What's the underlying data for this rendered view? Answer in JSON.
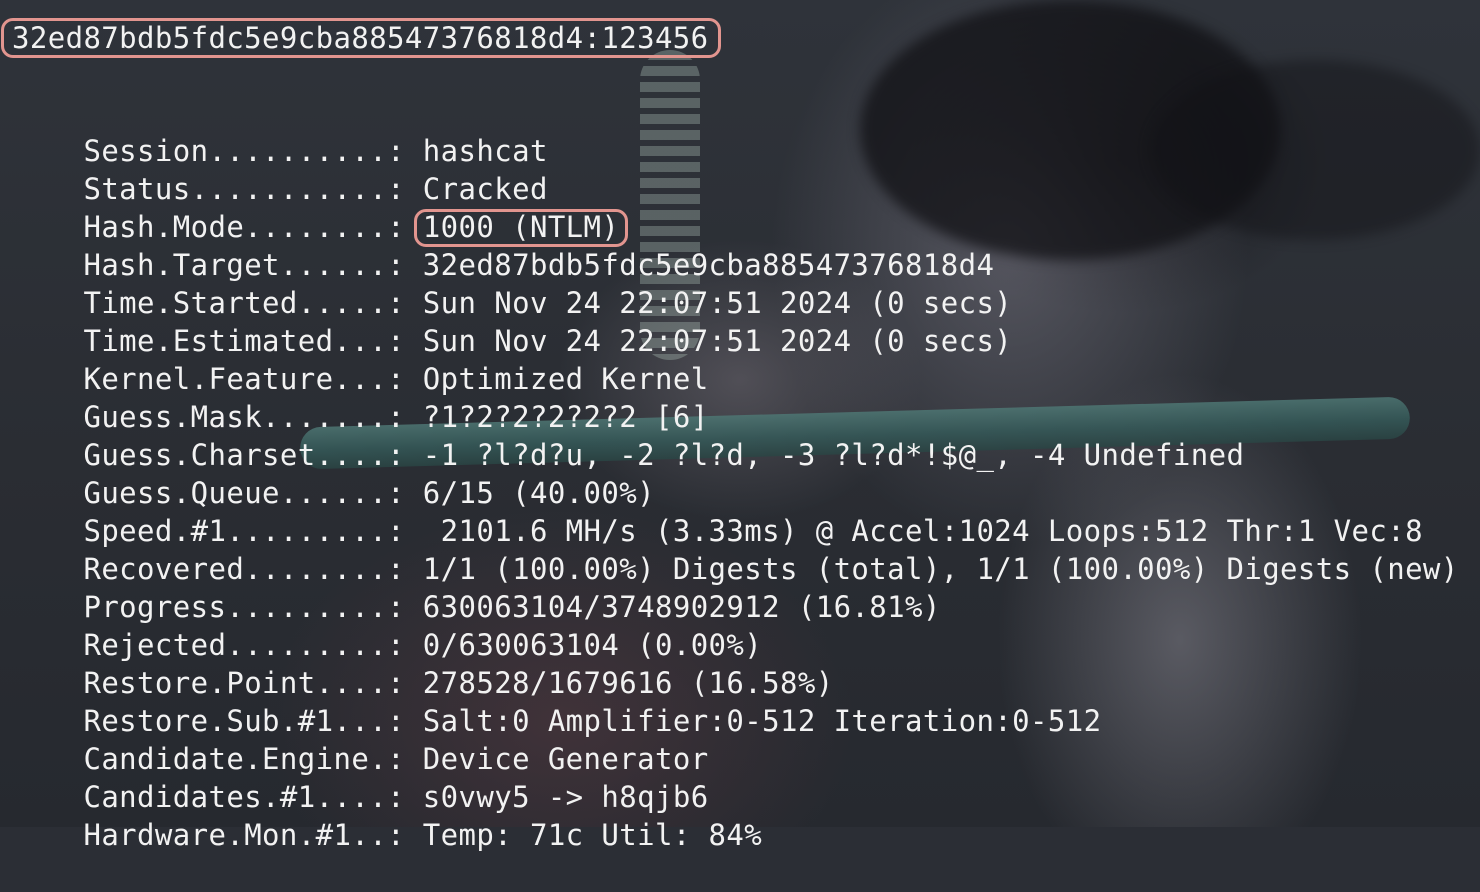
{
  "cracked_line": "32ed87bdb5fdc5e9cba88547376818d4:123456",
  "fields": [
    {
      "key": "Session..........: ",
      "value": "hashcat"
    },
    {
      "key": "Status...........: ",
      "value": "Cracked"
    },
    {
      "key": "Hash.Mode........: ",
      "value": "1000 (NTLM)"
    },
    {
      "key": "Hash.Target......: ",
      "value": "32ed87bdb5fdc5e9cba88547376818d4"
    },
    {
      "key": "Time.Started.....: ",
      "value": "Sun Nov 24 22:07:51 2024 (0 secs)"
    },
    {
      "key": "Time.Estimated...: ",
      "value": "Sun Nov 24 22:07:51 2024 (0 secs)"
    },
    {
      "key": "Kernel.Feature...: ",
      "value": "Optimized Kernel"
    },
    {
      "key": "Guess.Mask.......: ",
      "value": "?1?2?2?2?2?2 [6]"
    },
    {
      "key": "Guess.Charset....: ",
      "value": "-1 ?l?d?u, -2 ?l?d, -3 ?l?d*!$@_, -4 Undefined"
    },
    {
      "key": "Guess.Queue......: ",
      "value": "6/15 (40.00%)"
    },
    {
      "key": "Speed.#1.........: ",
      "value": " 2101.6 MH/s (3.33ms) @ Accel:1024 Loops:512 Thr:1 Vec:8"
    },
    {
      "key": "Recovered........: ",
      "value": "1/1 (100.00%) Digests (total), 1/1 (100.00%) Digests (new)"
    },
    {
      "key": "Progress.........: ",
      "value": "630063104/3748902912 (16.81%)"
    },
    {
      "key": "Rejected.........: ",
      "value": "0/630063104 (0.00%)"
    },
    {
      "key": "Restore.Point....: ",
      "value": "278528/1679616 (16.58%)"
    },
    {
      "key": "Restore.Sub.#1...: ",
      "value": "Salt:0 Amplifier:0-512 Iteration:0-512"
    },
    {
      "key": "Candidate.Engine.: ",
      "value": "Device Generator"
    },
    {
      "key": "Candidates.#1....: ",
      "value": "s0vwy5 -> h8qjb6"
    },
    {
      "key": "Hardware.Mon.#1..: ",
      "value": "Temp: 71c Util: 84%"
    }
  ],
  "colors": {
    "text": "#f2f2f2",
    "highlight_border": "#e2958f",
    "background": "#2b2e35"
  }
}
